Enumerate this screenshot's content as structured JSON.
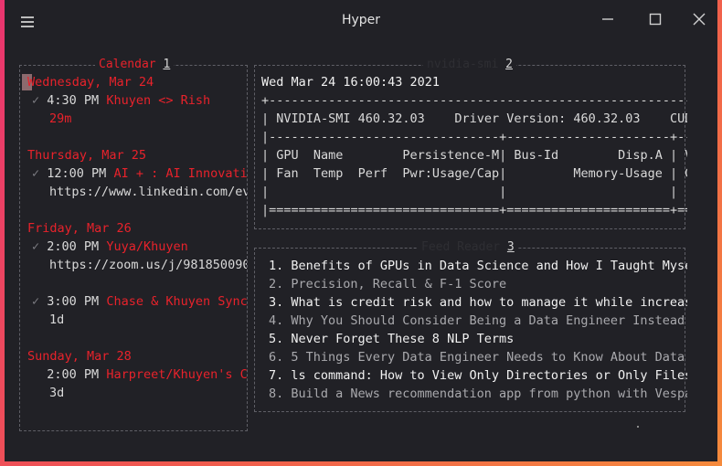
{
  "window": {
    "title": "Hyper"
  },
  "calendar": {
    "title": "Calendar",
    "num": "1",
    "days": [
      {
        "date": "Wednesday, Mar 24",
        "events": [
          {
            "time": "4:30 PM",
            "title": "Khuyen <> Rish",
            "detail": "29m",
            "checked": true
          }
        ]
      },
      {
        "date": "Thursday, Mar 25",
        "events": [
          {
            "time": "12:00 PM",
            "title": "AI + : AI Innovati",
            "detail": "https://www.linkedin.com/ev",
            "checked": true
          }
        ]
      },
      {
        "date": "Friday, Mar 26",
        "events": [
          {
            "time": "2:00 PM",
            "title": "Yuya/Khuyen",
            "detail": "https://zoom.us/j/981850090",
            "checked": true
          },
          {
            "time": "3:00 PM",
            "title": "Chase & Khuyen Sync",
            "detail": "1d",
            "checked": true
          }
        ]
      },
      {
        "date": "Sunday, Mar 28",
        "events": [
          {
            "time": "2:00 PM",
            "title": "Harpreet/Khuyen's C",
            "detail": "3d",
            "checked": false
          }
        ]
      }
    ]
  },
  "smi": {
    "title": "nvidia-smi",
    "num": "2",
    "lines": [
      "Wed Mar 24 16:00:43 2021",
      "+-----------------------------------------------------------",
      "| NVIDIA-SMI 460.32.03    Driver Version: 460.32.03    CUD",
      "|-------------------------------+----------------------+--",
      "| GPU  Name        Persistence-M| Bus-Id        Disp.A | V",
      "| Fan  Temp  Perf  Pwr:Usage/Cap|         Memory-Usage | G",
      "|                               |                      |",
      "|===============================+======================+=="
    ]
  },
  "news": {
    "title": "Feed Reader",
    "num": "3",
    "items": [
      "1. Benefits of GPUs in Data Science and How I Taught Myse",
      "2. Precision, Recall & F-1 Score",
      "3. What is credit risk and how to manage it while increas",
      "4. Why You Should Consider Being a Data Engineer Instead",
      "5. Never Forget These 8 NLP Terms",
      "6. 5 Things Every Data Engineer Needs to Know About Data",
      "7. ls command: How to View Only Directories or Only Files",
      "8. Build a News recommendation app from python with Vespa"
    ]
  }
}
